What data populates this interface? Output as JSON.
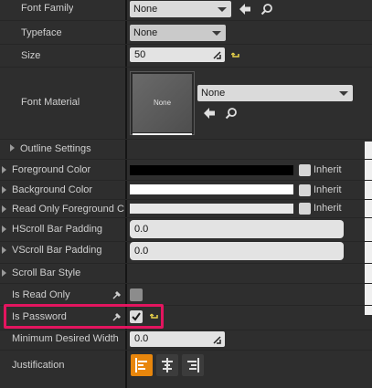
{
  "font_family": {
    "label": "Font Family",
    "value": "None"
  },
  "typeface": {
    "label": "Typeface",
    "value": "None"
  },
  "size": {
    "label": "Size",
    "value": "50"
  },
  "font_material": {
    "label": "Font Material",
    "value": "None",
    "thumbnail_text": "None"
  },
  "outline_settings": {
    "label": "Outline Settings"
  },
  "foreground_color": {
    "label": "Foreground Color",
    "color": "#000000",
    "inherit_label": "Inherit"
  },
  "background_color": {
    "label": "Background Color",
    "color": "#ffffff",
    "inherit_label": "Inherit"
  },
  "read_only_fg_color": {
    "label": "Read Only Foreground Co",
    "color": "#e8e8e8",
    "inherit_label": "Inherit"
  },
  "hscroll_bar_padding": {
    "label": "HScroll Bar Padding",
    "value": "0.0"
  },
  "vscroll_bar_padding": {
    "label": "VScroll Bar Padding",
    "value": "0.0"
  },
  "scroll_bar_style": {
    "label": "Scroll Bar Style"
  },
  "is_read_only": {
    "label": "Is Read Only",
    "checked": false
  },
  "is_password": {
    "label": "Is Password",
    "checked": true
  },
  "minimum_desired_width": {
    "label": "Minimum Desired Width",
    "value": "0.0"
  },
  "justification": {
    "label": "Justification",
    "options": [
      "left",
      "center",
      "right"
    ],
    "selected": "left"
  },
  "colors": {
    "panel_bg": "#2e2e2e",
    "highlight": "#e3155f",
    "accent": "#e8860c"
  }
}
